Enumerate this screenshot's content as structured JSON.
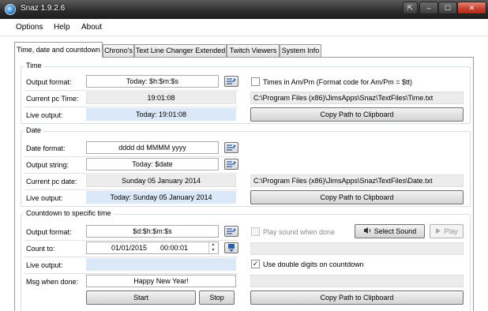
{
  "window": {
    "title": "Snaz 1.9.2.6",
    "tray_icon": "⇱",
    "min_icon": "–",
    "max_icon": "☐",
    "close_icon": "✕"
  },
  "menu": {
    "options": "Options",
    "help": "Help",
    "about": "About"
  },
  "tabs": [
    "Time, date and countdown",
    "Chrono's",
    "Text Line Changer Extended",
    "Twitch Viewers",
    "System Info"
  ],
  "time": {
    "group": "Time",
    "format_label": "Output format:",
    "format_value": "Today: $h:$m:$s",
    "ampm_label": "Times in Am/Pm (Format code for Am/Pm = $tt)",
    "current_label": "Current pc Time:",
    "current_value": "19:01:08",
    "path": "C:\\Program Files (x86)\\JimsApps\\Snaz\\TextFiles\\Time.txt",
    "live_label": "Live output:",
    "live_value": "Today: 19:01:08",
    "copy_label": "Copy Path to Clipboard"
  },
  "date": {
    "group": "Date",
    "format_label": "Date format:",
    "format_value": "dddd dd MMMM yyyy",
    "string_label": "Output string:",
    "string_value": "Today: $date",
    "current_label": "Current pc date:",
    "current_value": "Sunday 05 January 2014",
    "path": "C:\\Program Files (x86)\\JimsApps\\Snaz\\TextFiles\\Date.txt",
    "live_label": "Live output:",
    "live_value": "Today: Sunday 05 January 2014",
    "copy_label": "Copy Path to Clipboard"
  },
  "countdown": {
    "group": "Countdown to specific time",
    "format_label": "Output format:",
    "format_value": "$d:$h:$m:$s",
    "play_when_done": "Play sound when done",
    "select_sound": "Select Sound",
    "play": "Play",
    "count_label": "Count to:",
    "date_value": "01/01/2015",
    "time_value": "00:00:01",
    "live_label": "Live output:",
    "live_value": "",
    "double_digits": "Use double digits on countdown",
    "msg_label": "Msg when done:",
    "msg_value": "Happy New Year!",
    "start": "Start",
    "stop": "Stop",
    "copy_label": "Copy Path to Clipboard"
  },
  "icons": {
    "format_helper": "format-helper-icon",
    "spin_up": "▲",
    "spin_down": "▼",
    "calendar": "calendar-icon",
    "speaker": "speaker-icon",
    "play": "play-icon",
    "checkmark": "✓"
  }
}
